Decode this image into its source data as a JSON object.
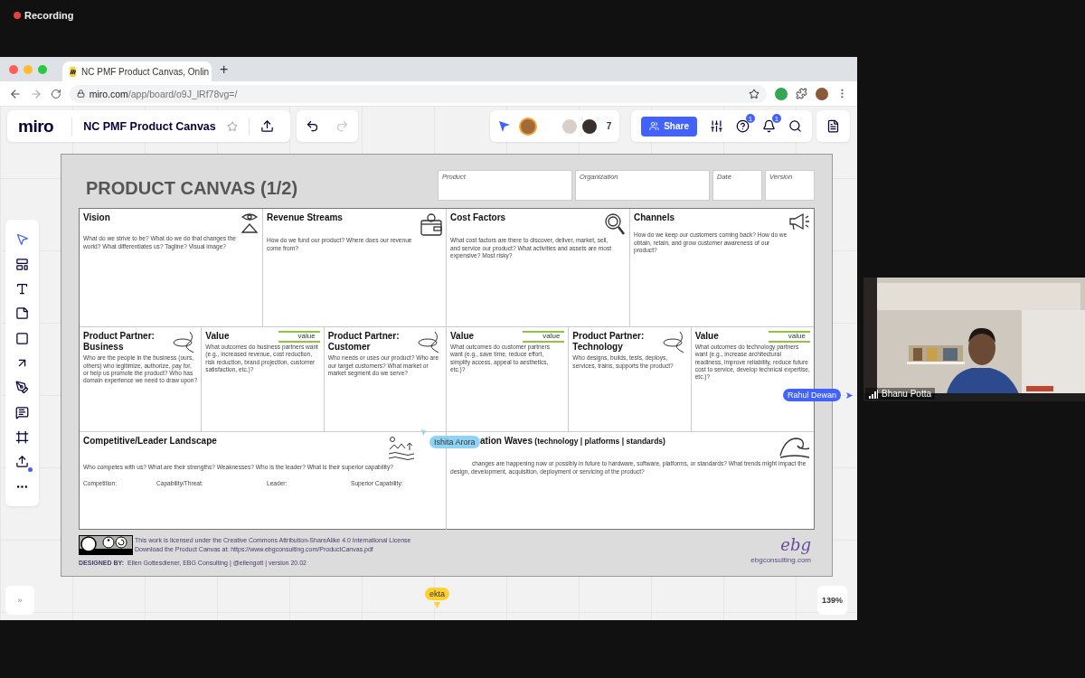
{
  "recording": {
    "label": "Recording"
  },
  "browser": {
    "tab_title": "NC PMF Product Canvas, Onlin",
    "new_tab": "+",
    "url_host": "miro.com",
    "url_path": "/app/board/o9J_lRf78vg=/"
  },
  "miro": {
    "logo": "miro",
    "board_title": "NC PMF Product Canvas",
    "collaborators": "7",
    "share": "Share",
    "help_badge": "1",
    "notification_badge": "1",
    "expand": "»",
    "zoom": "139%",
    "side_cursor": {
      "name": "Rahul Dewan",
      "color": "#4262ff"
    },
    "bottom_cursor": {
      "name": "ekta",
      "color": "#ffd02f"
    }
  },
  "canvas": {
    "title": "PRODUCT CANVAS (1/2)",
    "meta_fields": [
      "Product",
      "Organization",
      "Date",
      "Version"
    ],
    "cursor": {
      "name": "Ishita Arora",
      "color": "#8fd3f4"
    },
    "strategy_sections": [
      {
        "title": "Vision",
        "text": "What do we strive to be? What do we do that changes the world? What differentiates us? Tagline? Visual image?"
      },
      {
        "title": "Revenue Streams",
        "text": "How do we fund our product? Where does our revenue come from?"
      },
      {
        "title": "Cost Factors",
        "text": "What cost factors are there to discover, deliver, market, sell, and service our product? What activities and assets are most expensive? Most risky?"
      },
      {
        "title": "Channels",
        "text": "How do we keep our customers coming back? How do we obtain, retain, and grow customer awareness of our product?"
      }
    ],
    "partner_sections": [
      {
        "title": "Product Partner: Business",
        "text": "Who are the people in the business (ours, others) who legitimize, authorize, pay for, or help us promote the product? Who has domain experience we need to draw upon?"
      },
      {
        "title": "Value",
        "tag": "value",
        "text": "What outcomes do business partners want (e.g., increased revenue, cost reduction, risk reduction, brand projection, customer satisfaction, etc.)?"
      },
      {
        "title": "Product Partner: Customer",
        "text": "Who needs or uses our product? Who are our target customers? What market or market segment do we serve?"
      },
      {
        "title": "Value",
        "tag": "value",
        "text": "What outcomes do customer partners want (e.g., save time, reduce effort, simplify access, appeal to aesthetics, etc.)?"
      },
      {
        "title": "Product Partner: Technology",
        "text": "Who designs, builds, tests, deploys, services, trains, supports the product?"
      },
      {
        "title": "Value",
        "tag": "value",
        "text": "What outcomes do technology partners want (e.g., increase architectural readiness, improve reliability, reduce future cost to service, develop technical expertise, etc.)?"
      }
    ],
    "landscape_sections": [
      {
        "title": "Competitive/Leader Landscape",
        "text": "Who competes with us? What are their strengths? Weaknesses? Who is the leader? What is their superior capability?",
        "fields": [
          "Competition:",
          "Capability/Threat:",
          "Leader:",
          "Superior Capability:"
        ]
      },
      {
        "title": "ation Waves",
        "subtitle": "(technology  |  platforms |  standards)",
        "text": "changes are happening now or possibly in future to hardware, software, platforms, or standards? What trends might impact the design, development, acquisition, deployment or servicing of the product?"
      }
    ],
    "footer": {
      "license": "This work is licensed under the Creative Commons Attribution-ShareAlike 4.0 International License",
      "download": "Download the Product Canvas at: https://www.ebgconsulting.com/ProductCanvas.pdf",
      "designed_by": "DESIGNED BY:",
      "credits": "Ellen Gottesdiener, EBG Consulting | @ellengott | version 20.02",
      "logo": "ebg",
      "site": "ebgconsulting.com"
    }
  },
  "video": {
    "name": "Bhanu Potta"
  }
}
